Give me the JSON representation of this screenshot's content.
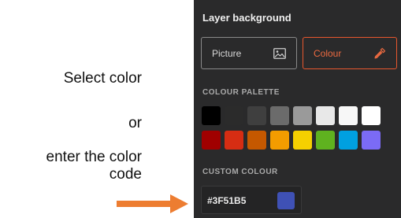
{
  "annotations": {
    "select": "Select color",
    "or": "or",
    "enter_line1": "enter the color",
    "enter_line2": "code",
    "arrow_color": "#ED7D31"
  },
  "panel": {
    "title": "Layer background",
    "modes": {
      "picture_label": "Picture",
      "picture_icon": "image-icon",
      "colour_label": "Colour",
      "colour_icon": "eyedropper-icon",
      "active": "colour",
      "active_color": "#E8572E"
    },
    "palette": {
      "label": "COLOUR PALETTE",
      "swatches": [
        "#000000",
        "#2B2B2B",
        "#3F3F3F",
        "#6B6B6B",
        "#9A9A9A",
        "#E8E8E8",
        "#F7F7F7",
        "#FFFFFF",
        "#A00000",
        "#D62D13",
        "#C55800",
        "#F39C00",
        "#F5D000",
        "#5FB21F",
        "#00A0E0",
        "#7B6BF5"
      ]
    },
    "custom": {
      "label": "CUSTOM COLOUR",
      "value": "#3F51B5"
    }
  }
}
